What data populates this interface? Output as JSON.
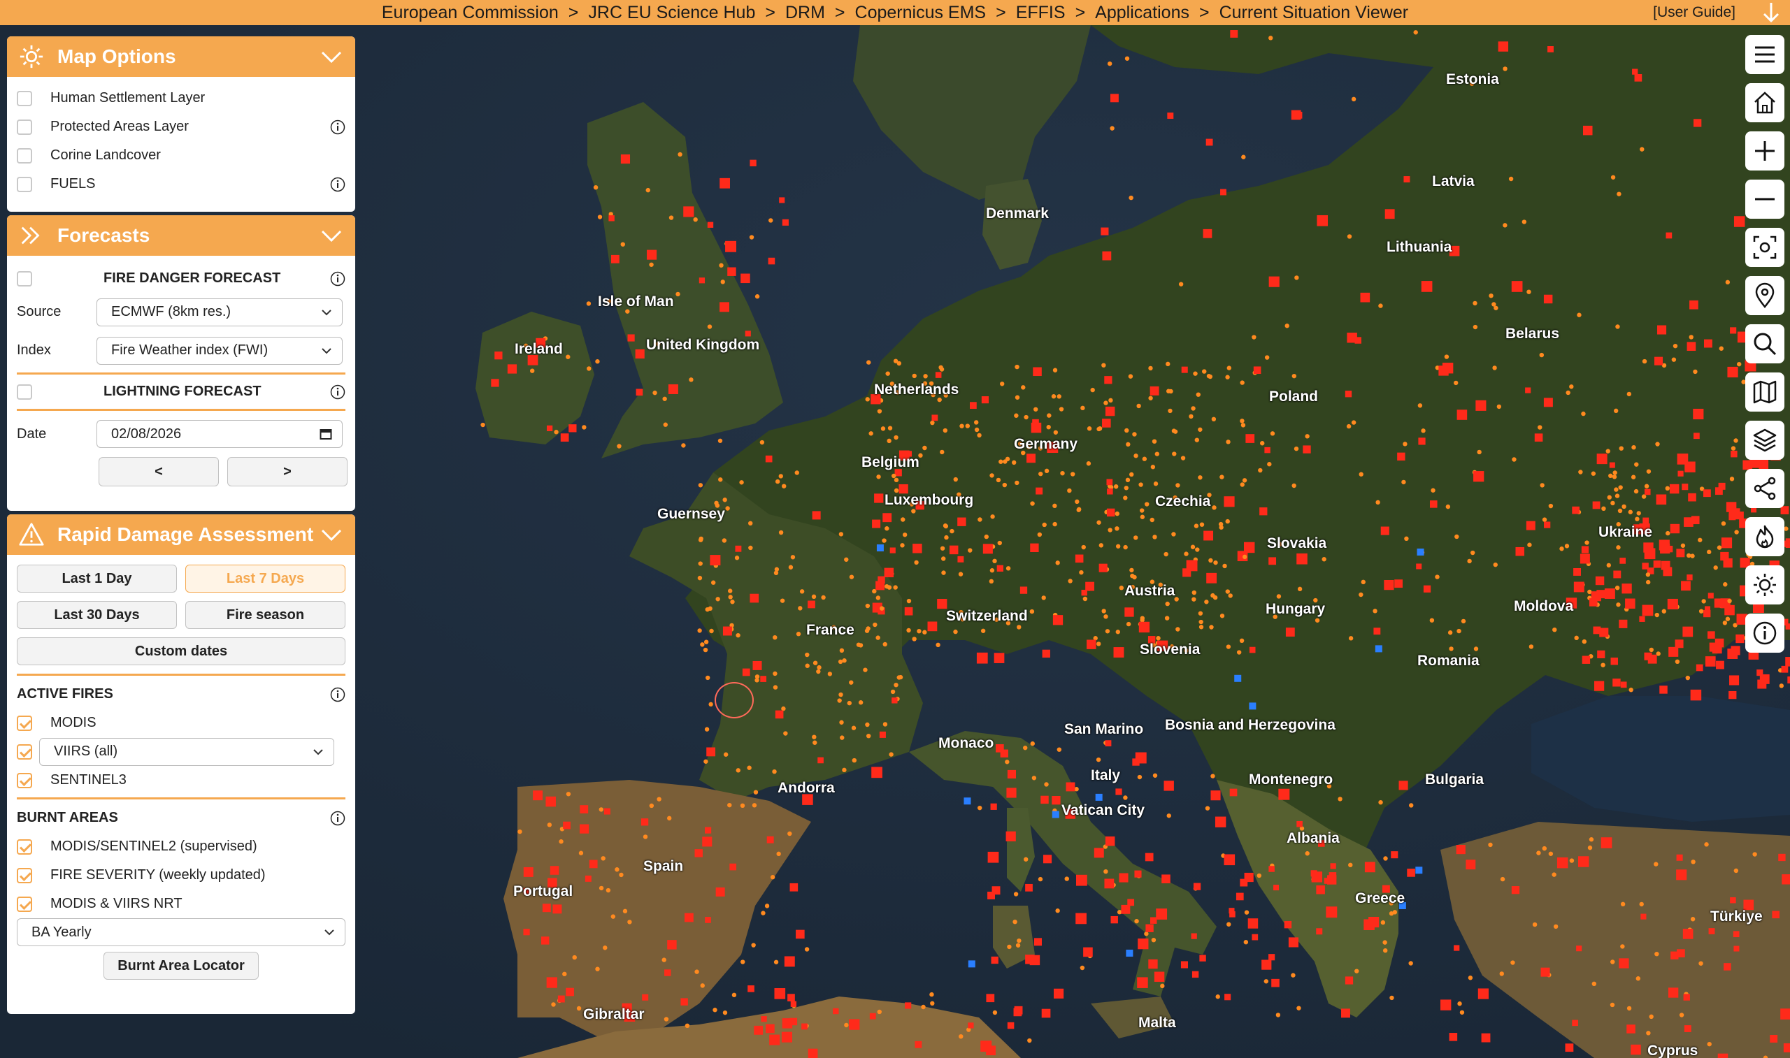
{
  "breadcrumb": [
    "European Commission",
    "JRC EU Science Hub",
    "DRM",
    "Copernicus EMS",
    "EFFIS",
    "Applications",
    "Current Situation Viewer"
  ],
  "breadcrumb_separator": ">",
  "user_guide": "[User Guide]",
  "colors": {
    "accent": "#f5a84f",
    "active_fire": "#ff2a1a",
    "hotspot": "#ff8a1f",
    "burnt": "#2a7fff"
  },
  "map_options": {
    "title": "Map Options",
    "layers": [
      {
        "label": "Human Settlement Layer",
        "checked": false,
        "info": false
      },
      {
        "label": "Protected Areas Layer",
        "checked": false,
        "info": true
      },
      {
        "label": "Corine Landcover",
        "checked": false,
        "info": false
      },
      {
        "label": "FUELS",
        "checked": false,
        "info": true
      }
    ]
  },
  "forecasts": {
    "title": "Forecasts",
    "fire_danger": {
      "label": "FIRE DANGER FORECAST",
      "checked": false
    },
    "source_label": "Source",
    "source_value": "ECMWF (8km res.)",
    "index_label": "Index",
    "index_value": "Fire Weather index (FWI)",
    "lightning": {
      "label": "LIGHTNING FORECAST",
      "checked": false
    },
    "date_label": "Date",
    "date_value": "02/08/2026",
    "prev_label": "<",
    "next_label": ">"
  },
  "rapid_damage": {
    "title": "Rapid Damage Assessment",
    "periods": [
      "Last 1 Day",
      "Last 7 Days",
      "Last 30 Days",
      "Fire season"
    ],
    "active_period": "Last 7 Days",
    "custom_dates": "Custom dates",
    "active_fires_title": "ACTIVE FIRES",
    "modis": "MODIS",
    "viirs_value": "VIIRS (all)",
    "sentinel3": "SENTINEL3",
    "burnt_areas_title": "BURNT AREAS",
    "burnt_layers": [
      "MODIS/SENTINEL2 (supervised)",
      "FIRE SEVERITY (weekly updated)",
      "MODIS & VIIRS NRT"
    ],
    "ba_value": "BA Yearly",
    "locator": "Burnt Area Locator"
  },
  "places": [
    "Estonia",
    "Latvia",
    "Denmark",
    "Lithuania",
    "Isle of Man",
    "Ireland",
    "United Kingdom",
    "Belarus",
    "Netherlands",
    "Poland",
    "Germany",
    "Belgium",
    "Luxembourg",
    "Czechia",
    "Guernsey",
    "Ukraine",
    "Slovakia",
    "Austria",
    "Hungary",
    "Moldova",
    "France",
    "Switzerland",
    "Slovenia",
    "Romania",
    "San Marino",
    "Bosnia and Herzegovina",
    "Monaco",
    "Italy",
    "Montenegro",
    "Bulgaria",
    "Andorra",
    "Vatican City",
    "Albania",
    "Portugal",
    "Spain",
    "Greece",
    "Türkiye",
    "Gibraltar",
    "Malta",
    "Cyprus"
  ],
  "toolbar_icons": [
    "menu-icon",
    "home-icon",
    "zoom-in-icon",
    "zoom-out-icon",
    "locate-icon",
    "pin-icon",
    "search-icon",
    "map-icon",
    "layers-icon",
    "share-icon",
    "fire-icon",
    "sun-icon",
    "info-icon"
  ]
}
